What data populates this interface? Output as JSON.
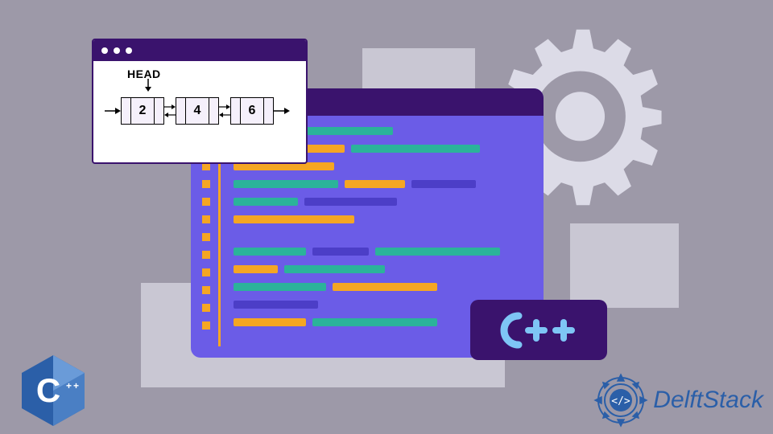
{
  "linked_list": {
    "head_label": "HEAD",
    "nodes": [
      "2",
      "4",
      "6"
    ]
  },
  "cpp_badge": {
    "text": "C++"
  },
  "c_logo": {
    "letter": "C",
    "suffix": "++"
  },
  "brand": {
    "name": "DelftStack"
  },
  "colors": {
    "dark_purple": "#3a136d",
    "med_purple": "#6b5ce7",
    "teal": "#2bb39a",
    "orange": "#f5a623",
    "gray_bg": "#9d99a8",
    "light_gray": "#c9c7d3"
  }
}
